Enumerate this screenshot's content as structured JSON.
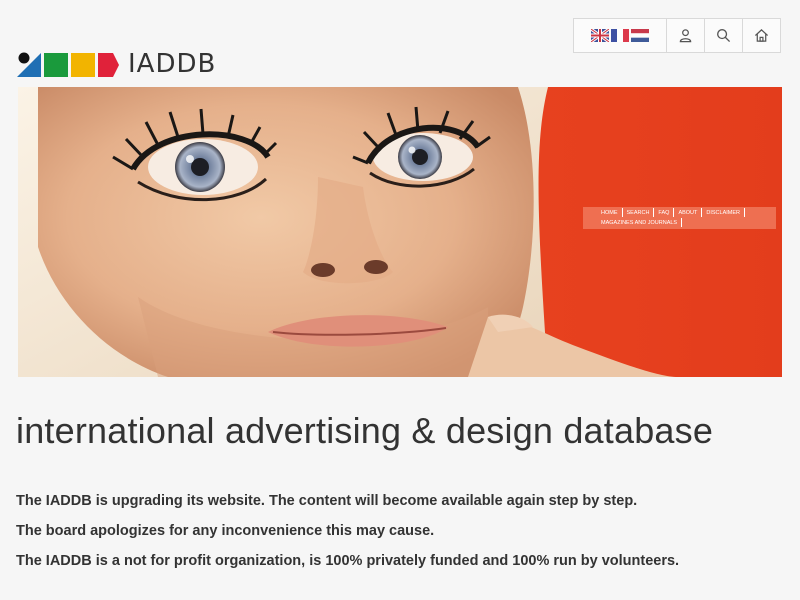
{
  "header": {
    "logo_text": "IADDB",
    "logo_colors": [
      "#1f6fb4",
      "#1a9a3c",
      "#f2b400",
      "#e0223a"
    ],
    "languages": [
      "English",
      "Français",
      "Nederlands"
    ],
    "icons": [
      "user-icon",
      "search-icon",
      "home-icon"
    ]
  },
  "hero": {
    "nav_items": [
      "Home",
      "Search",
      "FAQ",
      "About",
      "Disclaimer",
      "Magazines and journals"
    ],
    "background_color": "#e8401f"
  },
  "main": {
    "title": "international advertising & design database",
    "paragraphs": [
      "The IADDB is upgrading its website. The content will become available again step by step.",
      "The board apologizes for any inconvenience this may cause.",
      "The IADDB is a not for profit organization, is 100% privately funded and 100% run by volunteers."
    ]
  }
}
